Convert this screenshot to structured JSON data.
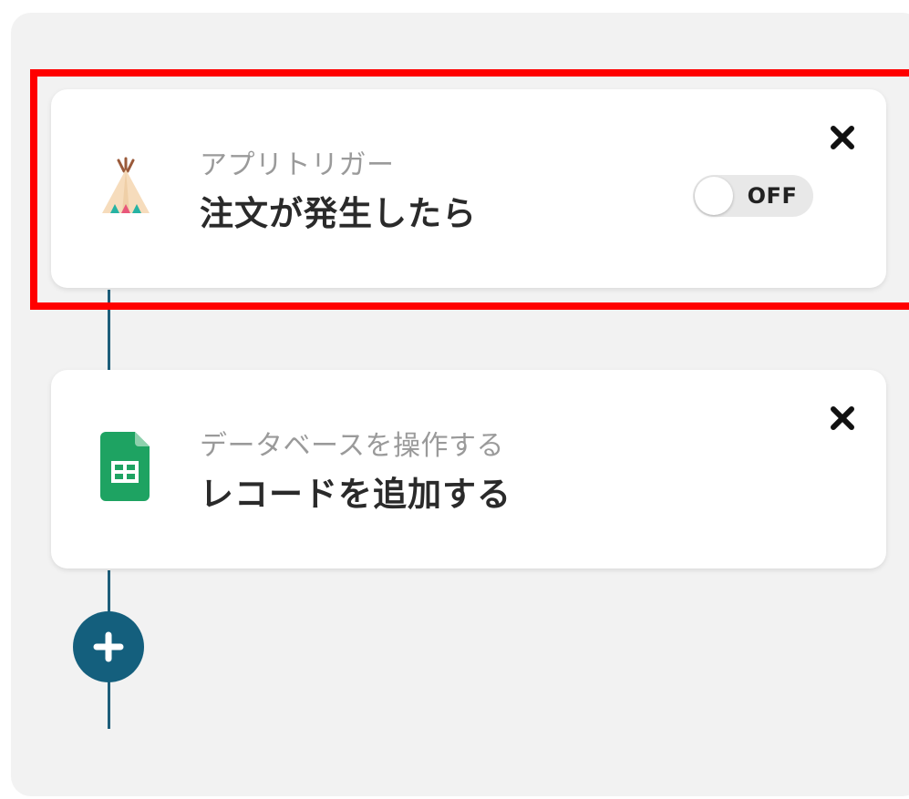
{
  "flow": {
    "trigger": {
      "type_label": "アプリトリガー",
      "title": "注文が発生したら",
      "app_icon": "teepee-icon",
      "toggle_label": "OFF",
      "toggle_state": "off",
      "remove_icon": "close-icon"
    },
    "action": {
      "type_label": "データベースを操作する",
      "title": "レコードを追加する",
      "app_icon": "google-sheets-icon",
      "remove_icon": "close-icon"
    },
    "add_step_icon": "plus-icon"
  },
  "colors": {
    "highlight": "#ff0000",
    "connector": "#1e5e7a",
    "add_button": "#145f7d",
    "sheets_green": "#1ea362",
    "panel_background": "#f2f2f2"
  }
}
